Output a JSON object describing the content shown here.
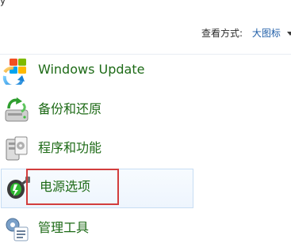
{
  "header": {
    "view_by_label": "查看方式:",
    "view_by_value": "大图标"
  },
  "items": [
    {
      "label": "Windows Update",
      "icon": "windows-update-icon"
    },
    {
      "label": "备份和还原",
      "icon": "backup-restore-icon"
    },
    {
      "label": "程序和功能",
      "icon": "programs-features-icon"
    },
    {
      "label": "电源选项",
      "icon": "power-options-icon",
      "hovered": true,
      "annotated": true
    },
    {
      "label": "管理工具",
      "icon": "admin-tools-icon"
    }
  ],
  "colors": {
    "link_green": "#1d6a16",
    "view_mode_blue": "#1f5ea8",
    "annotation_red": "#d23d3d",
    "hover_border": "#c7ddf4"
  }
}
